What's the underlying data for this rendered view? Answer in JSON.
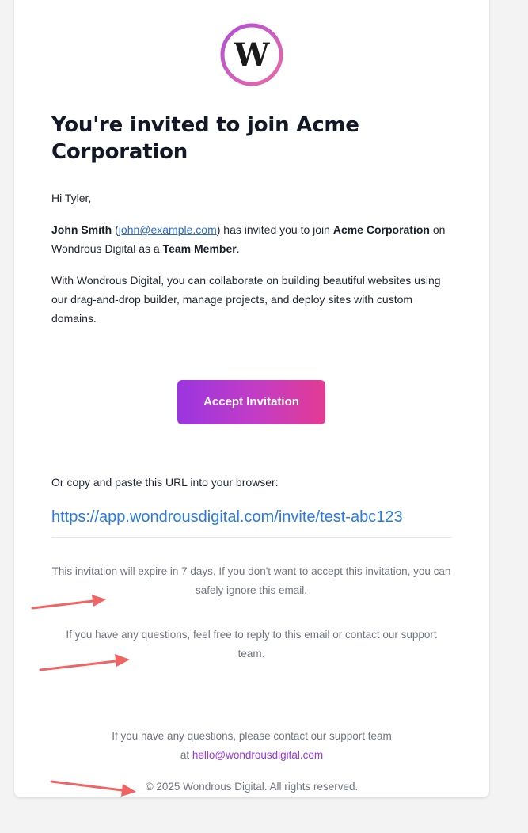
{
  "email": {
    "logo_letter": "W",
    "title": "You're invited to join Acme Corporation",
    "greeting": "Hi Tyler,",
    "inviter_name": "John Smith",
    "inviter_email": "john@example.com",
    "invite_text_1": "has invited you to join",
    "org_name": "Acme Corporation",
    "invite_text_2": "on Wondrous Digital as a",
    "role": "Team Member",
    "description": "With Wondrous Digital, you can collaborate on building beautiful websites using our drag-and-drop builder, manage projects, and deploy sites with custom domains.",
    "accept_button": "Accept Invitation",
    "copy_label": "Or copy and paste this URL into your browser:",
    "invite_url": "https://app.wondrousdigital.com/invite/test-abc123",
    "expire_note": "This invitation will expire in 7 days. If you don't want to accept this invitation, you can safely ignore this email.",
    "questions_note": "If you have any questions, feel free to reply to this email or contact our support team.",
    "footer_text": "If you have any questions, please contact our support team at",
    "support_email": "hello@wondrousdigital.com",
    "copyright": "© 2025 Wondrous Digital. All rights reserved."
  },
  "colors": {
    "accent_purple": "#9b35e0",
    "accent_pink": "#e23b93",
    "link_blue": "#2b7be0",
    "annotation_arrow": "#f06464"
  },
  "icons": {
    "logo": "wondrous-w-logo",
    "annotation": "red-arrow"
  }
}
